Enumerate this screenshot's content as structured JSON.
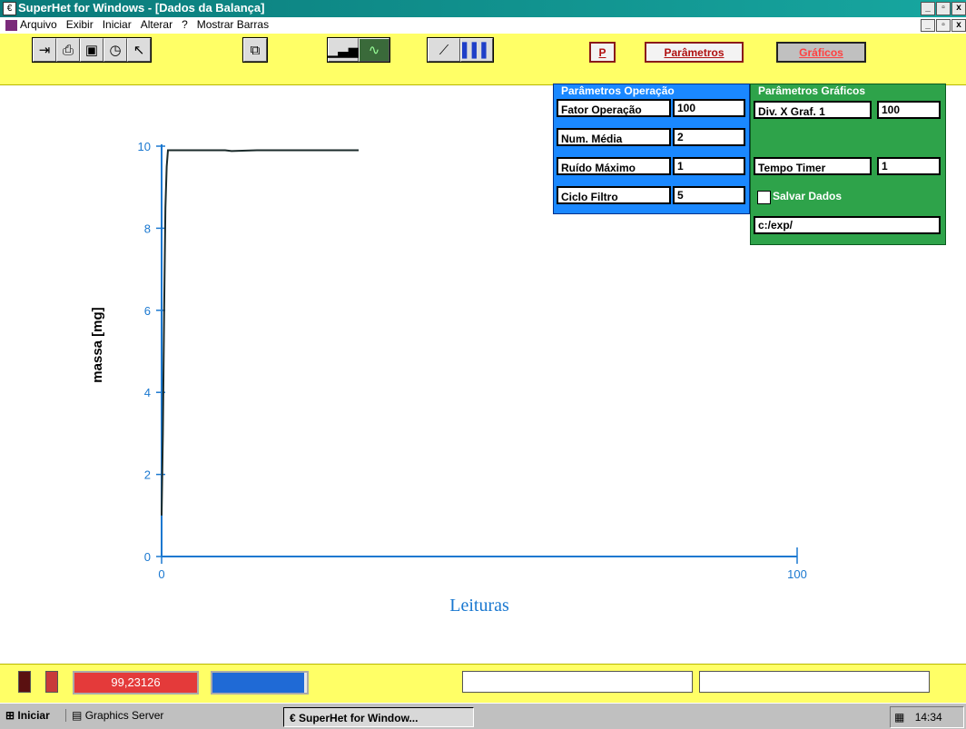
{
  "window": {
    "title": "SuperHet for Windows - [Dados da Balança]",
    "controls": [
      "_",
      "▫",
      "x"
    ],
    "mdi_controls": [
      "_",
      "▫",
      "x"
    ]
  },
  "menu": {
    "items": [
      "Arquivo",
      "Exibir",
      "Iniciar",
      "Alterar",
      "?",
      "Mostrar Barras"
    ]
  },
  "toolbar": {
    "buttons": {
      "p": "P",
      "parametros": "Parâmetros",
      "graficos": "Gráficos"
    }
  },
  "params_operacao": {
    "title": "Parâmetros Operação",
    "rows": [
      {
        "label": "Fator Operação",
        "value": "100"
      },
      {
        "label": "Num. Média",
        "value": "2"
      },
      {
        "label": "Ruído Máximo",
        "value": "1"
      },
      {
        "label": "Ciclo Filtro",
        "value": "5"
      }
    ]
  },
  "params_graficos": {
    "title": "Parâmetros Gráficos",
    "div_x_label": "Div. X Graf. 1",
    "div_x_value": "100",
    "tempo_label": "Tempo Timer",
    "tempo_value": "1",
    "salvar_label": "Salvar Dados",
    "salvar_checked": false,
    "path_value": "c:/exp/"
  },
  "chart_data": {
    "type": "line",
    "title": "",
    "xlabel": "Leituras",
    "ylabel": "massa  [mg]",
    "xlim": [
      0,
      100
    ],
    "ylim": [
      0,
      10
    ],
    "xticks": [
      "0",
      "100"
    ],
    "yticks": [
      "0",
      "2",
      "4",
      "6",
      "8",
      "10"
    ],
    "series": [
      {
        "x": [
          0,
          0.2,
          0.4,
          0.6,
          0.8,
          1,
          2,
          5,
          10,
          11,
          15,
          20,
          25,
          30,
          31
        ],
        "y": [
          1.0,
          3.0,
          6.0,
          8.5,
          9.5,
          9.9,
          9.9,
          9.9,
          9.9,
          9.88,
          9.9,
          9.9,
          9.9,
          9.9,
          9.9
        ]
      }
    ],
    "axis_color": "#1a78d0",
    "line_color": "#1a2a2a"
  },
  "status": {
    "main_value": "99,23126",
    "progress": 0.97,
    "field1": "",
    "field2": ""
  },
  "taskbar": {
    "start": "Iniciar",
    "graphics_server": "Graphics Server",
    "app": "SuperHet for Window...",
    "clock": "14:34"
  }
}
